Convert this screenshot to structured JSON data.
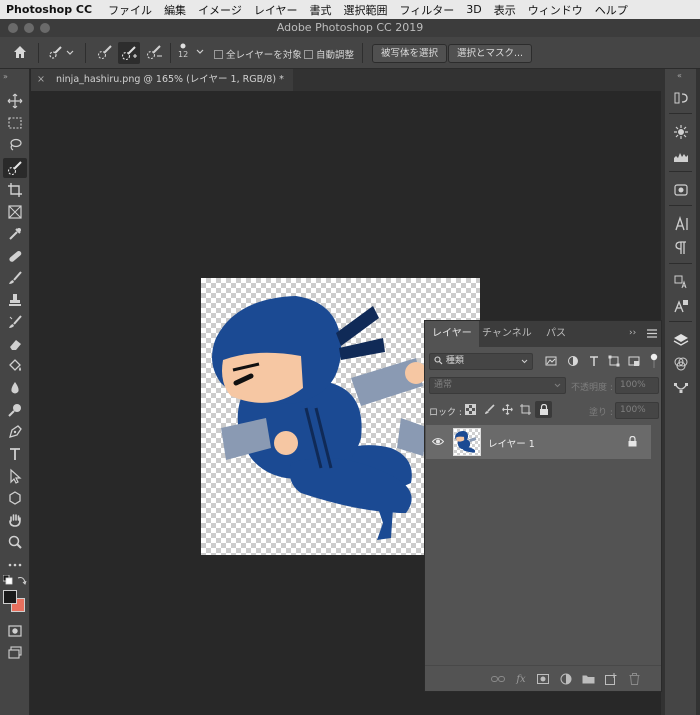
{
  "menubar": {
    "app": "Photoshop CC",
    "items": [
      "ファイル",
      "編集",
      "イメージ",
      "レイヤー",
      "書式",
      "選択範囲",
      "フィルター",
      "3D",
      "表示",
      "ウィンドウ",
      "ヘルプ"
    ]
  },
  "titlebar": {
    "title": "Adobe Photoshop CC 2019"
  },
  "options": {
    "brush_size": "12",
    "sample_all_label": "全レイヤーを対象",
    "auto_enhance_label": "自動調整",
    "select_subject": "被写体を選択",
    "select_mask": "選択とマスク..."
  },
  "document": {
    "tab_title": "ninja_hashiru.png @ 165% (レイヤー 1, RGB/8) *"
  },
  "layers_panel": {
    "tabs": [
      "レイヤー",
      "チャンネル",
      "パス"
    ],
    "kind_filter": "種類",
    "blend_mode": "通常",
    "opacity_label": "不透明度 :",
    "opacity_value": "100%",
    "lock_label": "ロック :",
    "fill_label": "塗り :",
    "fill_value": "100%",
    "layers": [
      {
        "name": "レイヤー 1",
        "visible": true,
        "locked": true
      }
    ]
  },
  "colors": {
    "ui_dark": "#282828",
    "panel": "#535353",
    "ninja_blue": "#1b4a93",
    "foreground": "#1a1a1a",
    "background": "#e8705e"
  }
}
